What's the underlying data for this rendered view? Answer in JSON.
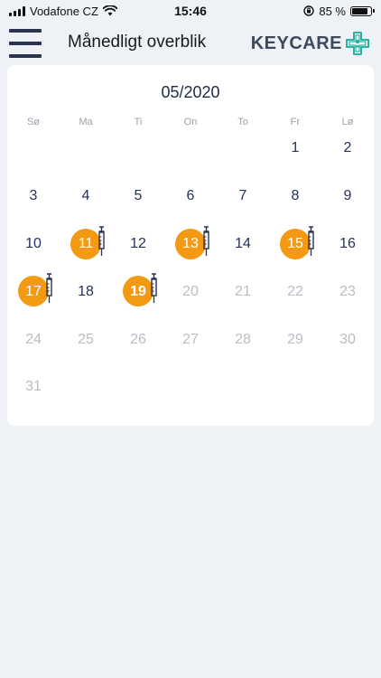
{
  "status_bar": {
    "carrier": "Vodafone CZ",
    "time": "15:46",
    "battery_text": "85 %",
    "battery_level": 0.85
  },
  "header": {
    "title": "Månedligt overblik",
    "logo_text": "KEYCARE",
    "menu_icon": "hamburger-menu-icon"
  },
  "calendar": {
    "month_label": "05/2020",
    "weekdays": [
      "Sø",
      "Ma",
      "Ti",
      "On",
      "To",
      "Fr",
      "Lø"
    ],
    "leading_blanks": 5,
    "days": [
      {
        "label": "1",
        "muted": false,
        "marked": false
      },
      {
        "label": "2",
        "muted": false,
        "marked": false
      },
      {
        "label": "3",
        "muted": false,
        "marked": false
      },
      {
        "label": "4",
        "muted": false,
        "marked": false
      },
      {
        "label": "5",
        "muted": false,
        "marked": false
      },
      {
        "label": "6",
        "muted": false,
        "marked": false
      },
      {
        "label": "7",
        "muted": false,
        "marked": false
      },
      {
        "label": "8",
        "muted": false,
        "marked": false
      },
      {
        "label": "9",
        "muted": false,
        "marked": false
      },
      {
        "label": "10",
        "muted": false,
        "marked": false
      },
      {
        "label": "11",
        "muted": false,
        "marked": true
      },
      {
        "label": "12",
        "muted": false,
        "marked": false
      },
      {
        "label": "13",
        "muted": false,
        "marked": true
      },
      {
        "label": "14",
        "muted": false,
        "marked": false
      },
      {
        "label": "15",
        "muted": false,
        "marked": true
      },
      {
        "label": "16",
        "muted": false,
        "marked": false
      },
      {
        "label": "17",
        "muted": false,
        "marked": true
      },
      {
        "label": "18",
        "muted": false,
        "marked": false
      },
      {
        "label": "19",
        "muted": false,
        "marked": true,
        "today": true
      },
      {
        "label": "20",
        "muted": true,
        "marked": false
      },
      {
        "label": "21",
        "muted": true,
        "marked": false
      },
      {
        "label": "22",
        "muted": true,
        "marked": false
      },
      {
        "label": "23",
        "muted": true,
        "marked": false
      },
      {
        "label": "24",
        "muted": true,
        "marked": false
      },
      {
        "label": "25",
        "muted": true,
        "marked": false
      },
      {
        "label": "26",
        "muted": true,
        "marked": false
      },
      {
        "label": "27",
        "muted": true,
        "marked": false
      },
      {
        "label": "28",
        "muted": true,
        "marked": false
      },
      {
        "label": "29",
        "muted": true,
        "marked": false
      },
      {
        "label": "30",
        "muted": true,
        "marked": false
      },
      {
        "label": "31",
        "muted": true,
        "marked": false
      }
    ],
    "marker_icon": "syringe-icon"
  },
  "colors": {
    "accent": "#f39a12",
    "day_text": "#24325a",
    "muted_text": "#b9bdc4",
    "background": "#eef1f5",
    "logo_teal": "#2bb3a8"
  }
}
